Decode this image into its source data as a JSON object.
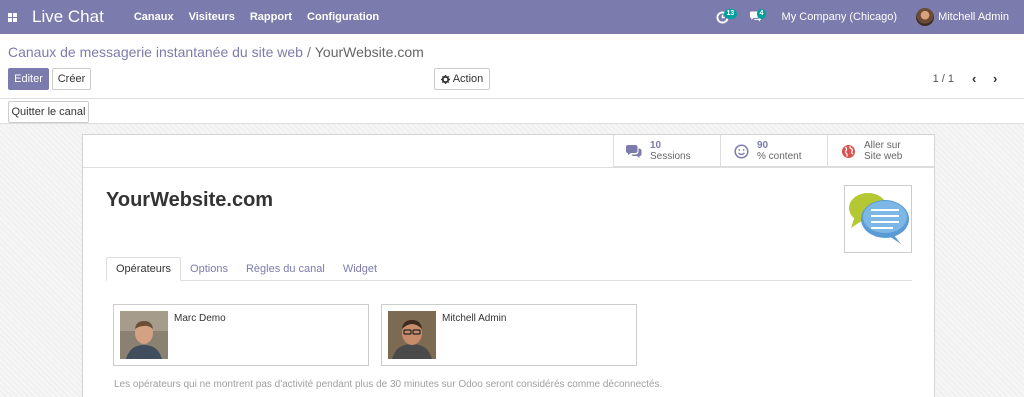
{
  "navbar": {
    "app_title": "Live Chat",
    "menu": [
      "Canaux",
      "Visiteurs",
      "Rapport",
      "Configuration"
    ],
    "activity_badge": "13",
    "messages_badge": "4",
    "company": "My Company (Chicago)",
    "user": "Mitchell Admin",
    "color": "#7c7bad"
  },
  "breadcrumb": {
    "parent": "Canaux de messagerie instantanée du site web",
    "separator": "/",
    "current": "YourWebsite.com"
  },
  "controls": {
    "edit_label": "Editer",
    "create_label": "Créer",
    "action_label": "Action",
    "pager": "1 / 1",
    "quit_label": "Quitter le canal"
  },
  "stats": [
    {
      "value": "10",
      "label": "Sessions",
      "icon": "comments-icon"
    },
    {
      "value": "90",
      "label": "% content",
      "icon": "smile-icon"
    },
    {
      "value": "Aller sur",
      "label": "Site web",
      "icon": "globe-icon"
    }
  ],
  "record": {
    "title": "YourWebsite.com"
  },
  "tabs": [
    "Opérateurs",
    "Options",
    "Règles du canal",
    "Widget"
  ],
  "operators": [
    {
      "name": "Marc Demo"
    },
    {
      "name": "Mitchell Admin"
    }
  ],
  "help_text": "Les opérateurs qui ne montrent pas d'activité pendant plus de 30 minutes sur Odoo seront considérés comme déconnectés."
}
